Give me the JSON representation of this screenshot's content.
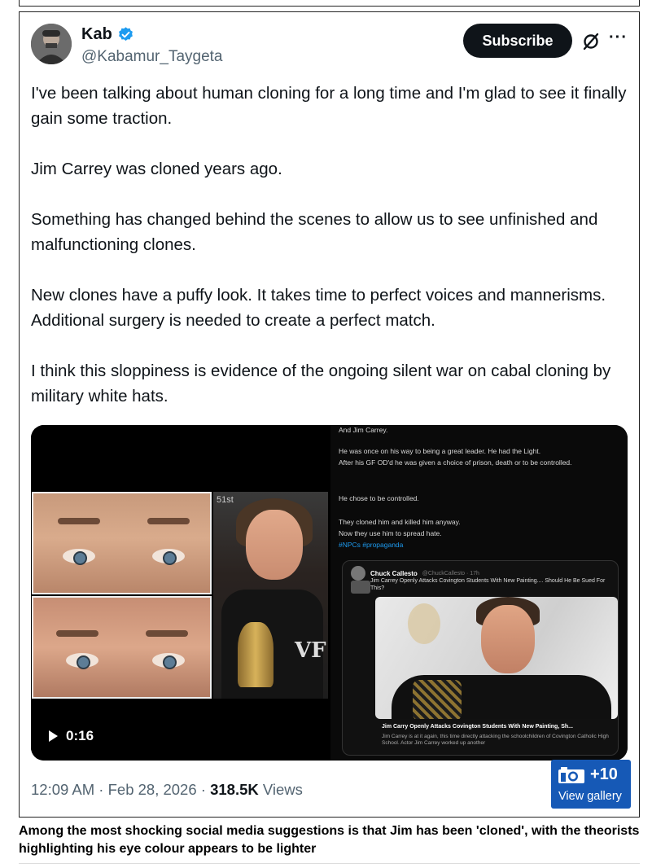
{
  "post": {
    "author_name": "Kab",
    "handle": "@Kabamur_Taygeta",
    "subscribe_label": "Subscribe",
    "more_label": "···",
    "paragraphs": [
      "I've been talking about human cloning for a long time and I'm glad to see it finally gain some traction.",
      "Jim Carrey was cloned years ago.",
      "Something has changed behind the scenes to allow us to see unfinished and malfunctioning clones.",
      "New clones have a puffy look. It takes time to perfect voices and mannerisms. Additional surgery is needed to create a perfect match.",
      "I think this sloppiness is evidence of the ongoing silent war on cabal cloning by military white hats."
    ],
    "video_duration": "0:16",
    "timestamp": "12:09 AM · Feb 28, 2026 · ",
    "views_count": "318.5K",
    "views_label": " Views"
  },
  "media_right": {
    "top_line": "And Jim Carrey.",
    "lines": [
      "He was once on his way to being a great leader. He had the Light.",
      "After his GF OD'd he was given a choice of prison, death or to be controlled.",
      "He chose to be controlled.",
      "They cloned him and killed him anyway.",
      "Now they use him to spread hate."
    ],
    "hashtags": "#NPCs #propaganda",
    "quote_name": "Chuck Callesto",
    "quote_meta": "@ChuckCallesto · 17h",
    "quote_text": "Jim Carrey Openly Attacks Covington Students With New Painting.... Should He Be Sued For This?",
    "article_title": "Jim Carry Openly Attacks Covington Students With New Painting, Sh...",
    "article_sub": "Jim Carrey is at it again, this time directly attacking the schoolchildren of Covington Catholic High School. Actor Jim Carrey worked up another",
    "portrait_badge": "51st",
    "vf_text": "VF"
  },
  "gallery": {
    "count": "+10",
    "label": "View gallery"
  },
  "caption": "Among the most shocking social media suggestions is that Jim has been 'cloned', with the theorists highlighting his eye colour appears to be lighter",
  "colors": {
    "verified_blue": "#1d9bf0",
    "gallery_blue": "#1659b6",
    "subscribe_bg": "#0f1419"
  }
}
